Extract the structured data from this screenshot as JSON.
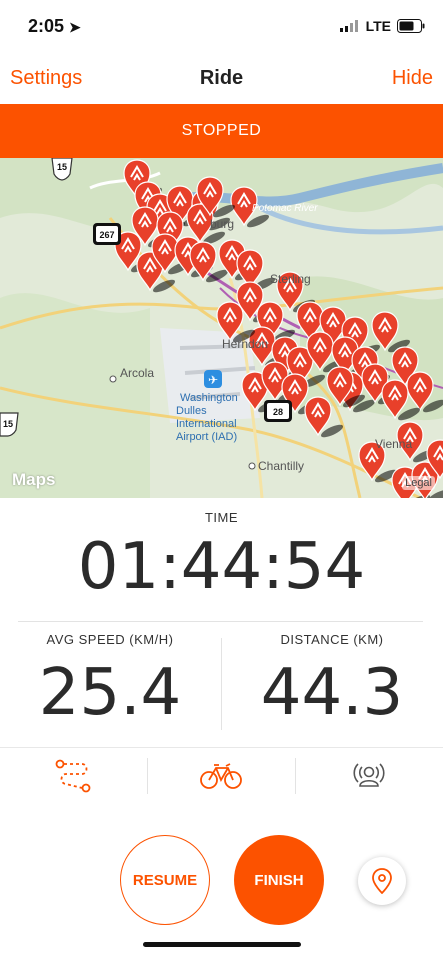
{
  "status_bar": {
    "time": "2:05",
    "network": "LTE"
  },
  "nav": {
    "left": "Settings",
    "title": "Ride",
    "right": "Hide"
  },
  "status_banner": "STOPPED",
  "map": {
    "labels": {
      "river": "Potomac River",
      "leesburg": "burg",
      "sterling": "Sterling",
      "herndon": "Herndon",
      "arcola": "Arcola",
      "airport": "Washington Dulles International Airport (IAD)",
      "chantilly": "Chantilly",
      "vienna": "Vienna"
    },
    "route_shields": [
      "15",
      "267",
      "28",
      "15"
    ],
    "attribution": "Maps",
    "legal": "Legal"
  },
  "stats": {
    "time_label": "TIME",
    "time_value": "01:44:54",
    "avg_speed_label": "AVG SPEED (KM/H)",
    "avg_speed_value": "25.4",
    "distance_label": "DISTANCE (KM)",
    "distance_value": "44.3"
  },
  "tabs": [
    "route-icon",
    "bike-icon",
    "beacon-icon"
  ],
  "actions": {
    "resume": "RESUME",
    "finish": "FINISH"
  },
  "colors": {
    "accent": "#fc5200",
    "pin": "#e8402a"
  }
}
